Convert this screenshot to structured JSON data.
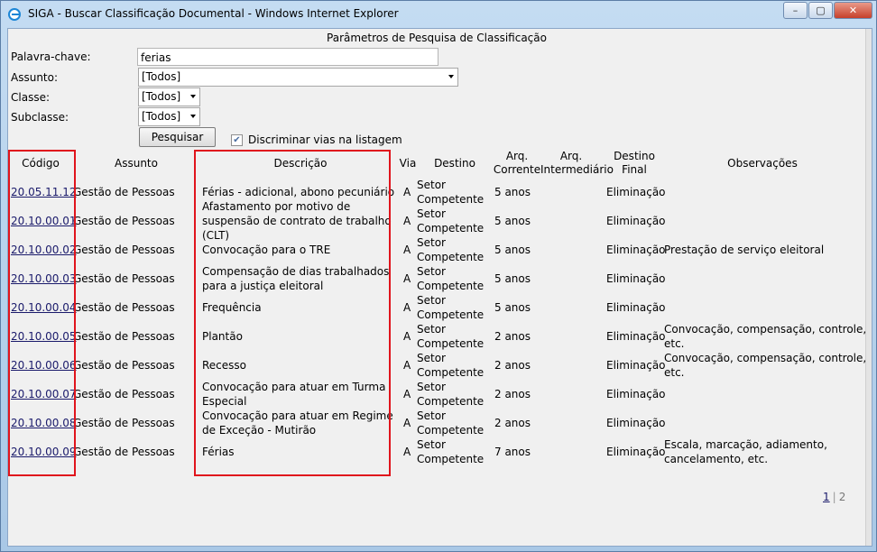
{
  "window": {
    "title": "SIGA - Buscar Classificação Documental - Windows Internet Explorer",
    "minimize": "–",
    "maximize": "▢",
    "close": "✕"
  },
  "form": {
    "title": "Parâmetros de Pesquisa de Classificação",
    "keyword_label": "Palavra-chave:",
    "keyword_value": "ferias",
    "assunto_label": "Assunto:",
    "assunto_value": "[Todos]",
    "classe_label": "Classe:",
    "classe_value": "[Todos]",
    "subclasse_label": "Subclasse:",
    "subclasse_value": "[Todos]",
    "search_button": "Pesquisar",
    "discriminar_label": "Discriminar vias na listagem",
    "discriminar_checked": "✔"
  },
  "table": {
    "headers": {
      "codigo": "Código",
      "assunto": "Assunto",
      "descricao": "Descrição",
      "via": "Via",
      "destino": "Destino",
      "arq_corrente_1": "Arq.",
      "arq_corrente_2": "Corrente",
      "arq_intermediario_1": "Arq.",
      "arq_intermediario_2": "Intermediário",
      "destino_final_1": "Destino",
      "destino_final_2": "Final",
      "observacoes": "Observações"
    },
    "rows": [
      {
        "codigo": "20.05.11.12",
        "assunto": "Gestão de Pessoas",
        "descricao_1": "Férias - adicional, abono pecuniário",
        "descricao_2": "",
        "descricao_3": "",
        "via": "A",
        "destino_1": "Setor",
        "destino_2": "Competente",
        "corrente": "5 anos",
        "final": "Eliminação",
        "obs_1": "",
        "obs_2": ""
      },
      {
        "codigo": "20.10.00.01",
        "assunto": "Gestão de Pessoas",
        "descricao_1": "Afastamento por motivo de",
        "descricao_2": "suspensão de contrato de trabalho",
        "descricao_3": "(CLT)",
        "via": "A",
        "destino_1": "Setor",
        "destino_2": "Competente",
        "corrente": "5 anos",
        "final": "Eliminação",
        "obs_1": "",
        "obs_2": ""
      },
      {
        "codigo": "20.10.00.02",
        "assunto": "Gestão de Pessoas",
        "descricao_1": "Convocação para o TRE",
        "descricao_2": "",
        "descricao_3": "",
        "via": "A",
        "destino_1": "Setor",
        "destino_2": "Competente",
        "corrente": "5 anos",
        "final": "Eliminação",
        "obs_1": "Prestação de serviço eleitoral",
        "obs_2": ""
      },
      {
        "codigo": "20.10.00.03",
        "assunto": "Gestão de Pessoas",
        "descricao_1": "Compensação de dias trabalhados",
        "descricao_2": "para a justiça eleitoral",
        "descricao_3": "",
        "via": "A",
        "destino_1": "Setor",
        "destino_2": "Competente",
        "corrente": "5 anos",
        "final": "Eliminação",
        "obs_1": "",
        "obs_2": ""
      },
      {
        "codigo": "20.10.00.04",
        "assunto": "Gestão de Pessoas",
        "descricao_1": "Frequência",
        "descricao_2": "",
        "descricao_3": "",
        "via": "A",
        "destino_1": "Setor",
        "destino_2": "Competente",
        "corrente": "5 anos",
        "final": "Eliminação",
        "obs_1": "",
        "obs_2": ""
      },
      {
        "codigo": "20.10.00.05",
        "assunto": "Gestão de Pessoas",
        "descricao_1": "Plantão",
        "descricao_2": "",
        "descricao_3": "",
        "via": "A",
        "destino_1": "Setor",
        "destino_2": "Competente",
        "corrente": "2 anos",
        "final": "Eliminação",
        "obs_1": "Convocação, compensação, controle,",
        "obs_2": "etc."
      },
      {
        "codigo": "20.10.00.06",
        "assunto": "Gestão de Pessoas",
        "descricao_1": "Recesso",
        "descricao_2": "",
        "descricao_3": "",
        "via": "A",
        "destino_1": "Setor",
        "destino_2": "Competente",
        "corrente": "2 anos",
        "final": "Eliminação",
        "obs_1": "Convocação, compensação, controle,",
        "obs_2": "etc."
      },
      {
        "codigo": "20.10.00.07",
        "assunto": "Gestão de Pessoas",
        "descricao_1": "Convocação para atuar em Turma",
        "descricao_2": "Especial",
        "descricao_3": "",
        "via": "A",
        "destino_1": "Setor",
        "destino_2": "Competente",
        "corrente": "2 anos",
        "final": "Eliminação",
        "obs_1": "",
        "obs_2": ""
      },
      {
        "codigo": "20.10.00.08",
        "assunto": "Gestão de Pessoas",
        "descricao_1": "Convocação para atuar em Regime",
        "descricao_2": "de Exceção - Mutirão",
        "descricao_3": "",
        "via": "A",
        "destino_1": "Setor",
        "destino_2": "Competente",
        "corrente": "2 anos",
        "final": "Eliminação",
        "obs_1": "",
        "obs_2": ""
      },
      {
        "codigo": "20.10.00.09",
        "assunto": "Gestão de Pessoas",
        "descricao_1": "Férias",
        "descricao_2": "",
        "descricao_3": "",
        "via": "A",
        "destino_1": "Setor",
        "destino_2": "Competente",
        "corrente": "7 anos",
        "final": "Eliminação",
        "obs_1": "Escala, marcação, adiamento,",
        "obs_2": "cancelamento, etc."
      }
    ]
  },
  "pager": {
    "current": "1",
    "separator": "|",
    "next": "2"
  }
}
